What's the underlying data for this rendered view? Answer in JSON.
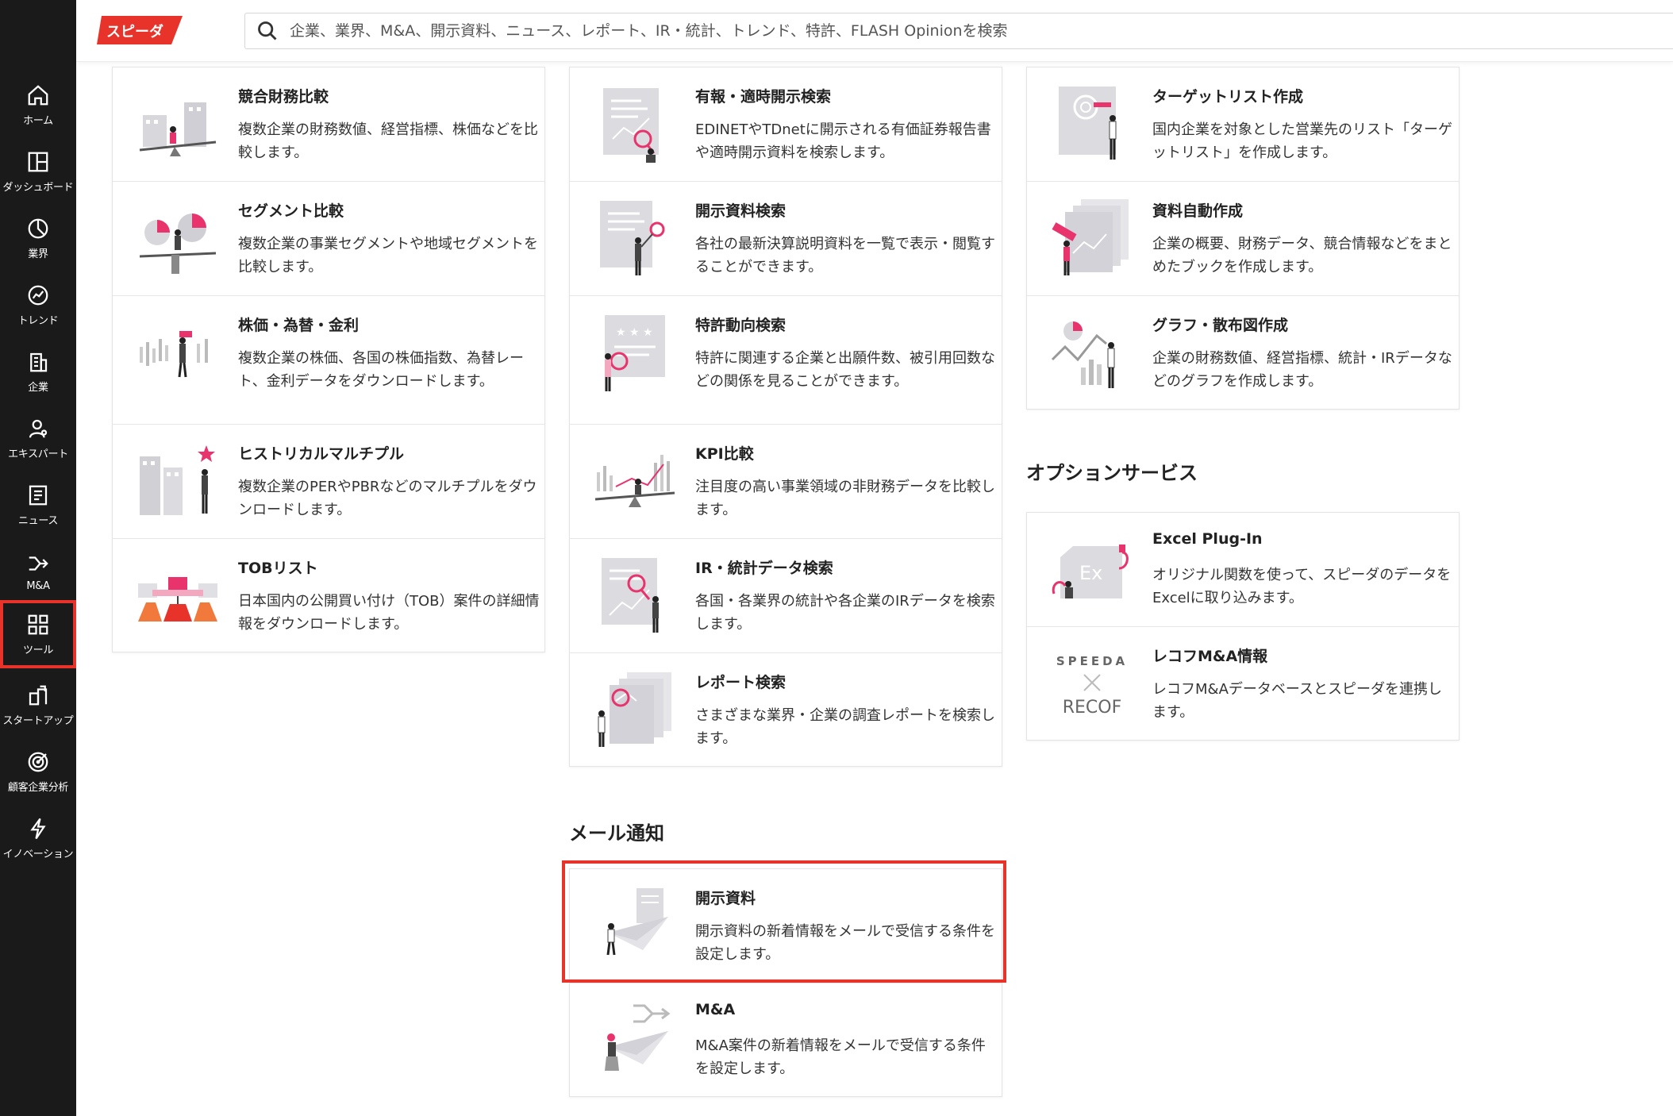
{
  "app": {
    "logo_text": "スピーダ",
    "brand_color": "#e8332a"
  },
  "search": {
    "placeholder": "企業、業界、M&A、開示資料、ニュース、レポート、IR・統計、トレンド、特許、FLASH Opinionを検索"
  },
  "sidebar": {
    "items": [
      {
        "label": "ホーム",
        "icon": "home-icon"
      },
      {
        "label": "ダッシュボード",
        "icon": "dashboard-icon"
      },
      {
        "label": "業界",
        "icon": "industry-pie-icon"
      },
      {
        "label": "トレンド",
        "icon": "trend-icon"
      },
      {
        "label": "企業",
        "icon": "company-building-icon"
      },
      {
        "label": "エキスパート",
        "icon": "expert-person-icon"
      },
      {
        "label": "ニュース",
        "icon": "news-icon"
      },
      {
        "label": "M&A",
        "icon": "merge-arrow-icon"
      },
      {
        "label": "ツール",
        "icon": "tools-grid-icon",
        "active": true
      },
      {
        "label": "スタートアップ",
        "icon": "startup-icon"
      },
      {
        "label": "顧客企業分析",
        "icon": "target-icon"
      },
      {
        "label": "イノベーション",
        "icon": "lightning-icon"
      }
    ]
  },
  "tools": {
    "col1": [
      {
        "title": "競合財務比較",
        "desc": "複数企業の財務数値、経営指標、株価などを比較します。",
        "icon": "seesaw-buildings-illustration"
      },
      {
        "title": "セグメント比較",
        "desc": "複数企業の事業セグメントや地域セグメントを比較します。",
        "icon": "pie-charts-seesaw-illustration"
      },
      {
        "title": "株価・為替・金利",
        "desc": "複数企業の株価、各国の株価指数、為替レート、金利データをダウンロードします。",
        "icon": "binoculars-chart-illustration"
      },
      {
        "title": "ヒストリカルマルチプル",
        "desc": "複数企業のPERやPBRなどのマルチプルをダウンロードします。",
        "icon": "buildings-star-illustration"
      },
      {
        "title": "TOBリスト",
        "desc": "日本国内の公開買い付け（TOB）案件の詳細情報をダウンロードします。",
        "icon": "tob-hands-illustration"
      }
    ],
    "col2": [
      {
        "title": "有報・適時開示検索",
        "desc": "EDINETやTDnetに開示される有価証券報告書や適時開示資料を検索します。",
        "icon": "document-magnifier-illustration"
      },
      {
        "title": "開示資料検索",
        "desc": "各社の最新決算説明資料を一覧で表示・閲覧することができます。",
        "icon": "document-person-illustration"
      },
      {
        "title": "特許動向検索",
        "desc": "特許に関連する企業と出願件数、被引用回数などの関係を見ることができます。",
        "icon": "patent-stars-illustration"
      },
      {
        "title": "KPI比較",
        "desc": "注目度の高い事業領域の非財務データを比較します。",
        "icon": "kpi-seesaw-illustration"
      },
      {
        "title": "IR・統計データ検索",
        "desc": "各国・各業界の統計や各企業のIRデータを検索します。",
        "icon": "ir-chart-magnifier-illustration"
      },
      {
        "title": "レポート検索",
        "desc": "さまざまな業界・企業の調査レポートを検索します。",
        "icon": "report-stack-illustration"
      }
    ],
    "col3": [
      {
        "title": "ターゲットリスト作成",
        "desc": "国内企業を対象とした営業先のリスト「ターゲットリスト」を作成します。",
        "icon": "target-list-illustration"
      },
      {
        "title": "資料自動作成",
        "desc": "企業の概要、財務データ、競合情報などをまとめたブックを作成します。",
        "icon": "auto-document-illustration"
      },
      {
        "title": "グラフ・散布図作成",
        "desc": "企業の財務数値、経営指標、統計・IRデータなどのグラフを作成します。",
        "icon": "graph-scatter-illustration"
      }
    ]
  },
  "option_services": {
    "heading": "オプションサービス",
    "items": [
      {
        "title": "Excel Plug-In",
        "desc": "オリジナル関数を使って、スピーダのデータをExcelに取り込みます。",
        "icon": "excel-plugin-illustration"
      },
      {
        "title": "レコフM&A情報",
        "desc": "レコフM&Aデータベースとスピーダを連携します。",
        "icon": "speeda-recof-logo",
        "logo_top": "SPEEDA",
        "logo_bottom": "RECOF"
      }
    ]
  },
  "mail_notifications": {
    "heading": "メール通知",
    "items": [
      {
        "title": "開示資料",
        "desc": "開示資料の新着情報をメールで受信する条件を設定します。",
        "icon": "paper-plane-document-illustration",
        "highlighted": true
      },
      {
        "title": "M&A",
        "desc": "M&A案件の新着情報をメールで受信する条件を設定します。",
        "icon": "paper-plane-arrows-illustration"
      }
    ]
  }
}
